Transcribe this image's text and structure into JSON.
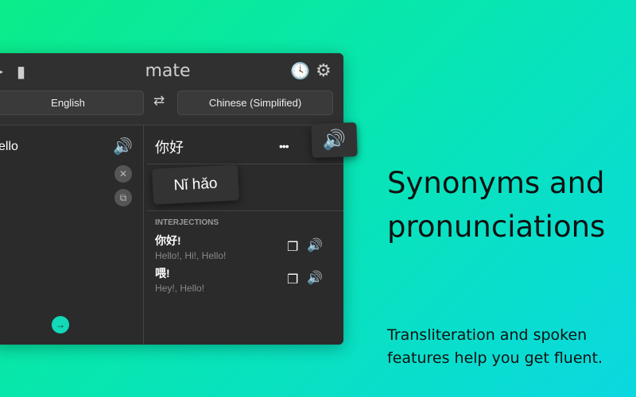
{
  "app": {
    "title": "mate"
  },
  "languages": {
    "source": "English",
    "target": "Chinese (Simplified)"
  },
  "input": {
    "text": "ello"
  },
  "result": {
    "text": "你好",
    "transliteration": "Nǐ hǎo"
  },
  "section": {
    "label": "INTERJECTIONS",
    "entries": [
      {
        "word": "你好!",
        "meanings": "Hello!, Hi!, Hello!"
      },
      {
        "word": "喂!",
        "meanings": "Hey!, Hello!"
      }
    ]
  },
  "icons": {
    "speaker": "🔊",
    "more": "•••",
    "close": "✕",
    "swap": "⇄",
    "arrow": "→",
    "copy": "❐",
    "history": "🕓",
    "settings": "⚙",
    "book": "▮"
  },
  "marketing": {
    "headline_1": "Synonyms and",
    "headline_2": "pronunciations",
    "subtext_1": "Transliteration and spoken",
    "subtext_2": "features help you get fluent."
  },
  "colors": {
    "accent": "#12d9b8"
  }
}
